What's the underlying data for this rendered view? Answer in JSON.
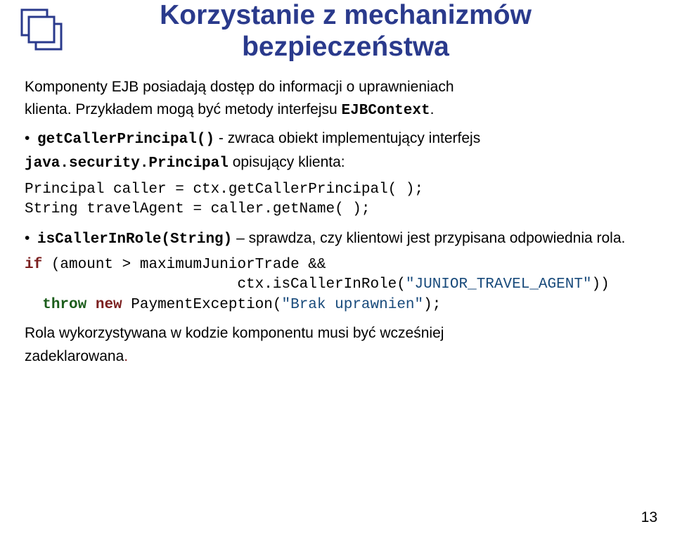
{
  "title_line1": "Korzystanie z mechanizmów",
  "title_line2": "bezpieczeństwa",
  "intro_a": "Komponenty EJB posiadają dostęp do informacji o uprawnieniach",
  "intro_b": "klienta. Przykładem mogą być metody interfejsu ",
  "intro_code": "EJBContext",
  "intro_dot": ".",
  "bullet1_code": "getCallerPrincipal()",
  "bullet1_text_a": " - zwraca obiekt implementujący interfejs ",
  "bullet1_code2a": "java.security.Principal",
  "bullet1_text_b": " opisujący klienta:",
  "code1_l1": "Principal caller = ctx.getCallerPrincipal( );",
  "code1_l2": "String travelAgent = caller.getName( );",
  "bullet2_code": "isCallerInRole(String)",
  "bullet2_text": " – sprawdza, czy klientowi jest przypisana odpowiednia rola.",
  "code2": {
    "if": "if",
    "cond_a": " (amount > maximumJuniorTrade &&",
    "indent": "                        ctx.isCallerInRole(",
    "str1": "\"JUNIOR_TRAVEL_AGENT\"",
    "close": "))",
    "throw": "throw",
    "new": "new",
    "exc": " PaymentException(",
    "str2": "\"Brak uprawnien\"",
    "end": ");"
  },
  "para3_a": "Rola wykorzystywana w kodzie komponentu musi być wcześniej",
  "para3_b": "zadeklarowana",
  "para3_dot": ".",
  "page_number": "13"
}
